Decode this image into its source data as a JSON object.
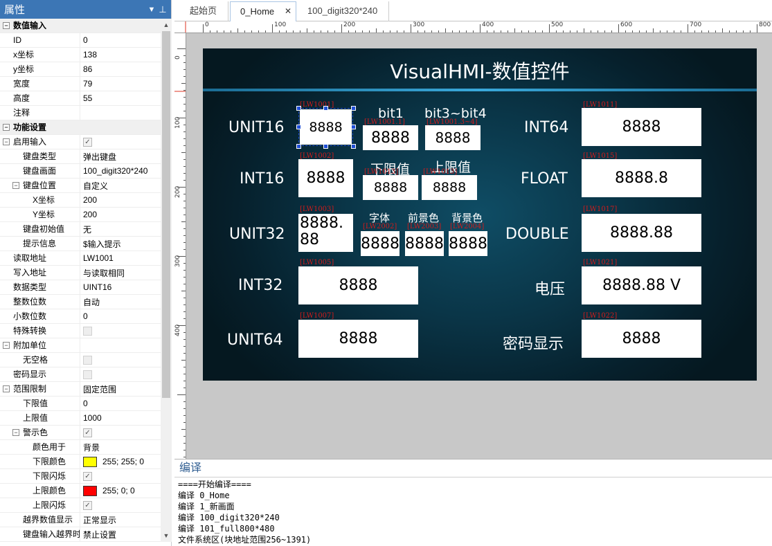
{
  "properties_panel": {
    "title": "属性",
    "dropdown_icon": "dropdown-arrow-icon",
    "pin_icon": "pin-icon"
  },
  "property_rows": [
    {
      "type": "cat",
      "name": "数值输入",
      "toggle": "⊟"
    },
    {
      "type": "prop",
      "name": "ID",
      "value": "0"
    },
    {
      "type": "prop",
      "name": "x坐标",
      "value": "138"
    },
    {
      "type": "prop",
      "name": "y坐标",
      "value": "86"
    },
    {
      "type": "prop",
      "name": "宽度",
      "value": "79"
    },
    {
      "type": "prop",
      "name": "高度",
      "value": "55"
    },
    {
      "type": "prop",
      "name": "注释",
      "value": ""
    },
    {
      "type": "cat",
      "name": "功能设置",
      "toggle": "⊟"
    },
    {
      "type": "prop",
      "name": "启用输入",
      "toggle": "⊟",
      "check": true
    },
    {
      "type": "prop",
      "name": "键盘类型",
      "value": "弹出键盘",
      "indent": 1
    },
    {
      "type": "prop",
      "name": "键盘画面",
      "value": "100_digit320*240",
      "indent": 1
    },
    {
      "type": "prop",
      "name": "键盘位置",
      "value": "自定义",
      "indent": 1,
      "toggle": "⊟"
    },
    {
      "type": "prop",
      "name": "X坐标",
      "value": "200",
      "indent": 2
    },
    {
      "type": "prop",
      "name": "Y坐标",
      "value": "200",
      "indent": 2
    },
    {
      "type": "prop",
      "name": "键盘初始值",
      "value": "无",
      "indent": 1
    },
    {
      "type": "prop",
      "name": "提示信息",
      "value": "$输入提示",
      "indent": 1
    },
    {
      "type": "prop",
      "name": "读取地址",
      "value": "LW1001"
    },
    {
      "type": "prop",
      "name": "写入地址",
      "value": "与读取相同"
    },
    {
      "type": "prop",
      "name": "数据类型",
      "value": "UINT16"
    },
    {
      "type": "prop",
      "name": "整数位数",
      "value": "自动"
    },
    {
      "type": "prop",
      "name": "小数位数",
      "value": "0"
    },
    {
      "type": "prop",
      "name": "特殊转换",
      "check": false
    },
    {
      "type": "prop",
      "name": "附加单位",
      "toggle": "⊟",
      "value": ""
    },
    {
      "type": "prop",
      "name": "无空格",
      "check": false,
      "indent": 1
    },
    {
      "type": "prop",
      "name": "密码显示",
      "check": false
    },
    {
      "type": "prop",
      "name": "范围限制",
      "value": "固定范围",
      "toggle": "⊟"
    },
    {
      "type": "prop",
      "name": "下限值",
      "value": "0",
      "indent": 1
    },
    {
      "type": "prop",
      "name": "上限值",
      "value": "1000",
      "indent": 1
    },
    {
      "type": "prop",
      "name": "警示色",
      "check": true,
      "indent": 1,
      "toggle": "⊟"
    },
    {
      "type": "prop",
      "name": "颜色用于",
      "value": "背景",
      "indent": 2
    },
    {
      "type": "prop",
      "name": "下限颜色",
      "value": "255; 255; 0",
      "color": "#ffff00",
      "indent": 2
    },
    {
      "type": "prop",
      "name": "下限闪烁",
      "check": true,
      "indent": 2
    },
    {
      "type": "prop",
      "name": "上限颜色",
      "value": "255; 0; 0",
      "color": "#ff0000",
      "indent": 2
    },
    {
      "type": "prop",
      "name": "上限闪烁",
      "check": true,
      "indent": 2
    },
    {
      "type": "prop",
      "name": "越界数值显示",
      "value": "正常显示",
      "indent": 1
    },
    {
      "type": "prop",
      "name": "键盘输入越界时",
      "value": "禁止设置",
      "indent": 1
    }
  ],
  "tabs": [
    {
      "label": "起始页"
    },
    {
      "label": "0_Home",
      "active": true,
      "close": "✕"
    },
    {
      "label": "100_digit320*240"
    }
  ],
  "ruler": {
    "h_ticks": [
      "0",
      "100",
      "200",
      "300",
      "400",
      "500",
      "600",
      "700",
      "800"
    ],
    "v_ticks": [
      "0",
      "100",
      "200",
      "300",
      "400"
    ]
  },
  "hmi": {
    "title": "VisualHMI-数值控件",
    "labels": {
      "unit16": "UNIT16",
      "int16": "INT16",
      "unit32": "UNIT32",
      "int32": "INT32",
      "unit64": "UNIT64",
      "int64": "INT64",
      "float": "FLOAT",
      "double": "DOUBLE",
      "voltage": "电压",
      "password": "密码显示",
      "bit1": "bit1",
      "bit3_4": "bit3~bit4",
      "lower": "下限值",
      "upper": "上限值",
      "font": "字体",
      "fg": "前景色",
      "bg": "背景色"
    },
    "values": {
      "unit16": "8888",
      "bit1": "8888",
      "bit3_4": "8888",
      "int16": "8888",
      "lower": "8888",
      "upper": "8888",
      "unit32": "8888.88",
      "font": "8888",
      "fg": "8888",
      "bg": "8888",
      "int32": "8888",
      "unit64": "8888",
      "int64": "8888",
      "float": "8888.8",
      "double": "8888.88",
      "voltage": "8888.88 V",
      "password": "8888"
    },
    "addrs": {
      "unit16": "[LW1001]",
      "bit1": "[LW1001.1]",
      "bit3_4": "[LW1001.3~4]",
      "int16": "[LW1002]",
      "lower": "[LW1013]",
      "upper": "[LW1013]",
      "unit32": "[LW1003]",
      "font": "[LW2002]",
      "fg": "[LW2003]",
      "bg": "[LW2004]",
      "int32": "[LW1005]",
      "unit64": "[LW1007]",
      "int64": "[LW1011]",
      "float": "[LW1015]",
      "double": "[LW1017]",
      "voltage": "[LW1021]",
      "password": "[LW1022]"
    }
  },
  "output": {
    "title": "编译",
    "lines": [
      "====开始编译====",
      "编译 0_Home",
      "编译 1_新画面",
      "编译 100_digit320*240",
      "编译 101_full800*480",
      "文件系统区(块地址范围256~1391)"
    ]
  }
}
